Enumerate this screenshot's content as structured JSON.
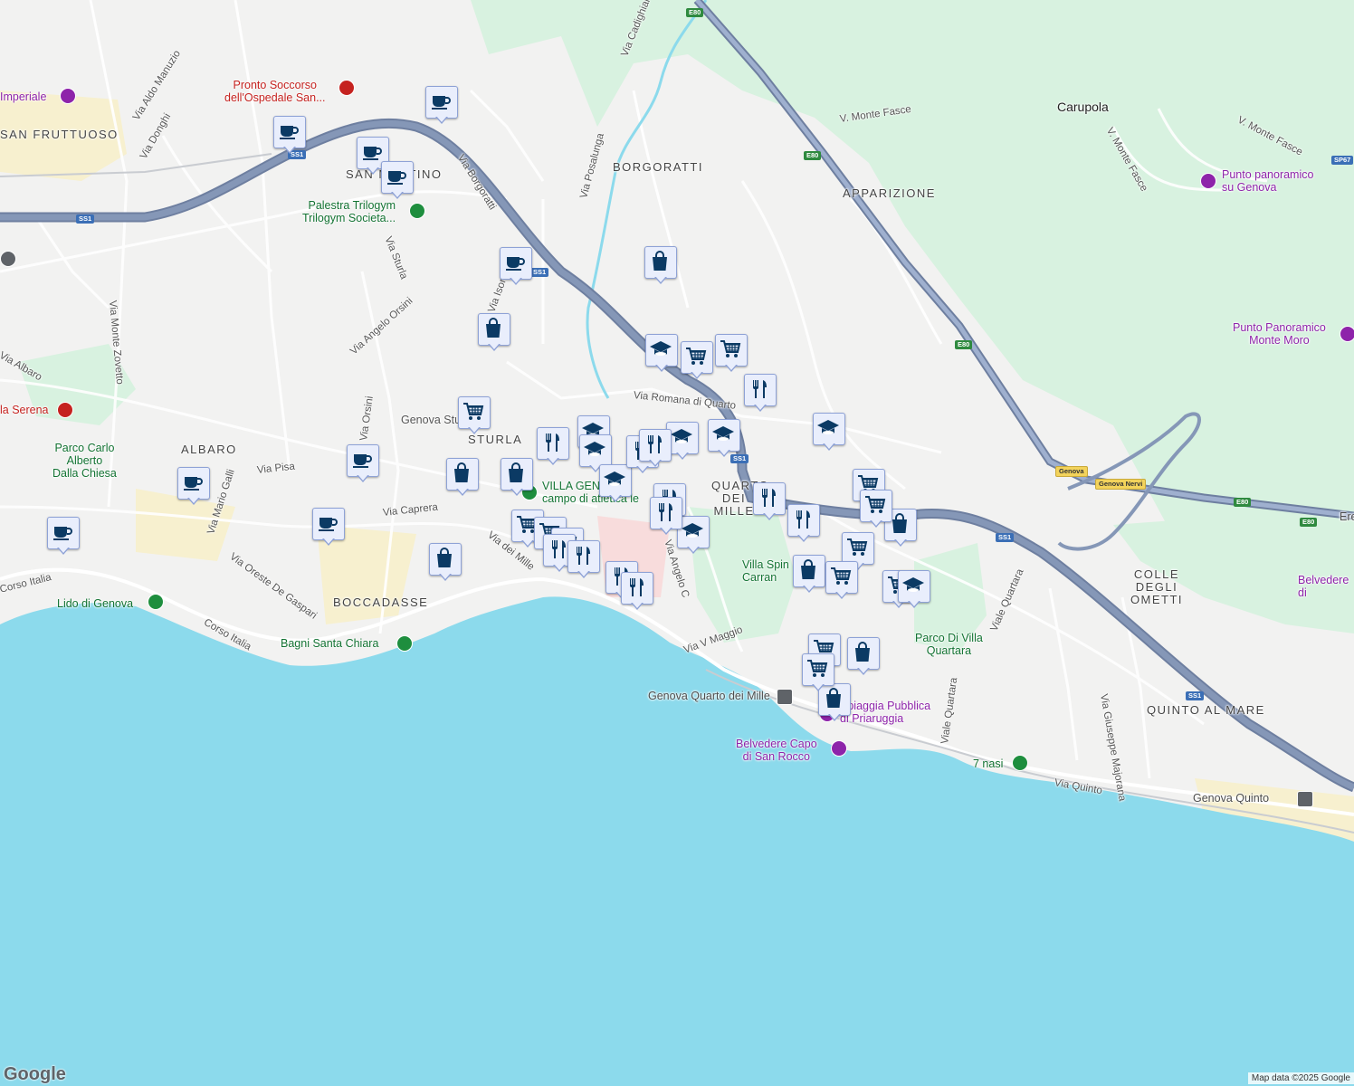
{
  "map": {
    "colors": {
      "water": "#8cdaec",
      "land": "#f2f2f1",
      "park": "#d8f2e0",
      "highway": "#8597b7",
      "highway_outline": "#6e7fa0",
      "dense": "#e6e6e4",
      "yellow_block": "#f7ecb0"
    },
    "area_labels": [
      {
        "id": "san-fruttuoso",
        "text": "SAN FRUTTUOSO"
      },
      {
        "id": "borgoratti",
        "text": "BORGORATTI"
      },
      {
        "id": "apparizione",
        "text": "APPARIZIONE"
      },
      {
        "id": "sturla",
        "text": "STURLA"
      },
      {
        "id": "albaro",
        "text": "ALBARO"
      },
      {
        "id": "boccadasse",
        "text": "BOCCADASSE"
      },
      {
        "id": "quarto-dei-mille",
        "text": "QUARTO DEI MILLE"
      },
      {
        "id": "colle-degli-ometti",
        "text": "COLLE DEGLI OMETTI"
      },
      {
        "id": "quinto-al-mare",
        "text": "QUINTO AL MARE"
      },
      {
        "id": "san-martino",
        "text": "SAN MARTINO"
      }
    ],
    "town_labels": [
      {
        "id": "carupola",
        "text": "Carupola"
      }
    ],
    "street_labels": [
      {
        "id": "via-aldo-manuzio",
        "text": "Via Aldo Manuzio"
      },
      {
        "id": "via-donghi",
        "text": "Via Donghi"
      },
      {
        "id": "via-borgoratti",
        "text": "Via Borgoratti"
      },
      {
        "id": "via-cadighiara",
        "text": "Via Cadighiara"
      },
      {
        "id": "via-posalunga",
        "text": "Via Posalunga"
      },
      {
        "id": "v-monte-fasce-1",
        "text": "V. Monte Fasce"
      },
      {
        "id": "v-monte-fasce-2",
        "text": "V. Monte Fasce"
      },
      {
        "id": "v-monte-fasce-3",
        "text": "V. Monte Fasce"
      },
      {
        "id": "via-sturla",
        "text": "Via Sturla"
      },
      {
        "id": "via-isonzo",
        "text": "Via Isonzo"
      },
      {
        "id": "via-monte-zovetto",
        "text": "Via Monte Zovetto"
      },
      {
        "id": "via-angelo-orsini",
        "text": "Via Angelo Orsini"
      },
      {
        "id": "via-albaro",
        "text": "Via Albaro"
      },
      {
        "id": "via-romana-di-quarto",
        "text": "Via Romana di Quarto"
      },
      {
        "id": "genova-sturla",
        "text": "Genova Stu"
      },
      {
        "id": "via-pisa",
        "text": "Via Pisa"
      },
      {
        "id": "via-mario-galli",
        "text": "Via Mario Galli"
      },
      {
        "id": "via-caprera",
        "text": "Via Caprera"
      },
      {
        "id": "via-dei-mille",
        "text": "Via dei Mille"
      },
      {
        "id": "via-oreste-de-gaspari",
        "text": "Via Oreste De Gaspari"
      },
      {
        "id": "corso-italia-1",
        "text": "Corso Italia"
      },
      {
        "id": "corso-italia-2",
        "text": "Corso Italia"
      },
      {
        "id": "via-angelo-carrara",
        "text": "Via Angelo C"
      },
      {
        "id": "via-v-maggio",
        "text": "Via V Maggio"
      },
      {
        "id": "viale-quartara-1",
        "text": "Viale Quartara"
      },
      {
        "id": "viale-quartara-2",
        "text": "Viale Quartara"
      },
      {
        "id": "via-giuseppe-majorana",
        "text": "Via Giuseppe Majorana"
      },
      {
        "id": "via-quinto",
        "text": "Via Quinto"
      },
      {
        "id": "via-orsini",
        "text": "Via Orsini"
      }
    ],
    "poi_labels": [
      {
        "id": "pronto-soccorso",
        "text": "Pronto Soccorso\ndell'Ospedale San...",
        "kind": "hospital"
      },
      {
        "id": "imperiale",
        "text": "Imperiale",
        "kind": "attraction"
      },
      {
        "id": "palestra-trilogym",
        "text": "Palestra Trilogym\nTrilogym Societa...",
        "kind": "sport"
      },
      {
        "id": "villa-serena",
        "text": "la Serena",
        "kind": "hospital"
      },
      {
        "id": "parco-carlo-alberto",
        "text": "Parco Carlo\nAlberto\nDalla Chiesa",
        "kind": "park"
      },
      {
        "id": "lido-di-genova",
        "text": "Lido di Genova",
        "kind": "sport"
      },
      {
        "id": "bagni-santa-chiara",
        "text": "Bagni Santa Chiara",
        "kind": "sport"
      },
      {
        "id": "villa-gentile",
        "text": "VILLA GEN\ncampo di atletica le",
        "kind": "sport"
      },
      {
        "id": "villa-spinola",
        "text": "Villa Spin\nCarran",
        "kind": "park"
      },
      {
        "id": "genova-quarto",
        "text": "Genova Quarto dei Mille",
        "kind": "transit"
      },
      {
        "id": "spiaggia-priaruggia",
        "text": "Spiaggia Pubblica\ndi Priaruggia",
        "kind": "attraction"
      },
      {
        "id": "belvedere-capo-san-rocco",
        "text": "Belvedere Capo\ndi San Rocco",
        "kind": "attraction"
      },
      {
        "id": "parco-villa-quartara",
        "text": "Parco Di Villa\nQuartara",
        "kind": "park"
      },
      {
        "id": "sette-nasi",
        "text": "7 nasi",
        "kind": "sport"
      },
      {
        "id": "genova-quinto",
        "text": "Genova Quinto",
        "kind": "transit"
      },
      {
        "id": "punto-panoramico-genova",
        "text": "Punto panoramico\nsu Genova",
        "kind": "attraction"
      },
      {
        "id": "punto-panoramico-monte-moro",
        "text": "Punto Panoramico\nMonte Moro",
        "kind": "attraction"
      },
      {
        "id": "belvedere-right",
        "text": "Belvedere\ndi",
        "kind": "attraction"
      },
      {
        "id": "ere",
        "text": "Ere",
        "kind": "place"
      }
    ],
    "road_shields": [
      {
        "id": "ss1-a",
        "text": "SS1",
        "kind": "blue"
      },
      {
        "id": "ss1-b",
        "text": "SS1",
        "kind": "blue"
      },
      {
        "id": "ss1-c",
        "text": "SS1",
        "kind": "blue"
      },
      {
        "id": "ss1-d",
        "text": "SS1",
        "kind": "blue"
      },
      {
        "id": "ss1-e",
        "text": "SS1",
        "kind": "blue"
      },
      {
        "id": "ss1-f",
        "text": "SS1",
        "kind": "blue"
      },
      {
        "id": "e80-a",
        "text": "E80",
        "kind": "green"
      },
      {
        "id": "e80-b",
        "text": "E80",
        "kind": "green"
      },
      {
        "id": "e80-c",
        "text": "E80",
        "kind": "green"
      },
      {
        "id": "e80-d",
        "text": "E80",
        "kind": "green"
      },
      {
        "id": "e80-e",
        "text": "E80",
        "kind": "green"
      },
      {
        "id": "sp67",
        "text": "SP67",
        "kind": "blue"
      },
      {
        "id": "genova-exit",
        "text": "Genova",
        "kind": "yellow"
      },
      {
        "id": "genova-nervi-exit",
        "text": "Genova Nervi",
        "kind": "yellow"
      }
    ],
    "markers": [
      {
        "type": "cafe",
        "icon": "coffee-cup-icon"
      },
      {
        "type": "cafe",
        "icon": "coffee-cup-icon"
      },
      {
        "type": "cafe",
        "icon": "coffee-cup-icon"
      },
      {
        "type": "cafe",
        "icon": "coffee-cup-icon"
      },
      {
        "type": "cafe",
        "icon": "coffee-cup-icon"
      },
      {
        "type": "cafe",
        "icon": "coffee-cup-icon"
      },
      {
        "type": "cafe",
        "icon": "coffee-cup-icon"
      },
      {
        "type": "cafe",
        "icon": "coffee-cup-icon"
      },
      {
        "type": "cafe",
        "icon": "coffee-cup-icon"
      },
      {
        "type": "shop",
        "icon": "shopping-bag-icon"
      },
      {
        "type": "shop",
        "icon": "shopping-bag-icon"
      },
      {
        "type": "shop",
        "icon": "shopping-bag-icon"
      },
      {
        "type": "shop",
        "icon": "shopping-bag-icon"
      },
      {
        "type": "shop",
        "icon": "shopping-bag-icon"
      },
      {
        "type": "shop",
        "icon": "shopping-bag-icon"
      },
      {
        "type": "shop",
        "icon": "shopping-bag-icon"
      },
      {
        "type": "shop",
        "icon": "shopping-bag-icon"
      },
      {
        "type": "shop",
        "icon": "shopping-bag-icon"
      },
      {
        "type": "grocery",
        "icon": "shopping-cart-icon"
      },
      {
        "type": "grocery",
        "icon": "shopping-cart-icon"
      },
      {
        "type": "grocery",
        "icon": "shopping-cart-icon"
      },
      {
        "type": "grocery",
        "icon": "shopping-cart-icon"
      },
      {
        "type": "grocery",
        "icon": "shopping-cart-icon"
      },
      {
        "type": "grocery",
        "icon": "shopping-cart-icon"
      },
      {
        "type": "grocery",
        "icon": "shopping-cart-icon"
      },
      {
        "type": "grocery",
        "icon": "shopping-cart-icon"
      },
      {
        "type": "grocery",
        "icon": "shopping-cart-icon"
      },
      {
        "type": "grocery",
        "icon": "shopping-cart-icon"
      },
      {
        "type": "grocery",
        "icon": "shopping-cart-icon"
      },
      {
        "type": "grocery",
        "icon": "shopping-cart-icon"
      },
      {
        "type": "grocery",
        "icon": "shopping-cart-icon"
      },
      {
        "type": "school",
        "icon": "graduation-cap-icon"
      },
      {
        "type": "school",
        "icon": "graduation-cap-icon"
      },
      {
        "type": "school",
        "icon": "graduation-cap-icon"
      },
      {
        "type": "school",
        "icon": "graduation-cap-icon"
      },
      {
        "type": "school",
        "icon": "graduation-cap-icon"
      },
      {
        "type": "school",
        "icon": "graduation-cap-icon"
      },
      {
        "type": "school",
        "icon": "graduation-cap-icon"
      },
      {
        "type": "school",
        "icon": "graduation-cap-icon"
      },
      {
        "type": "school",
        "icon": "graduation-cap-icon"
      },
      {
        "type": "restaurant",
        "icon": "fork-knife-icon"
      },
      {
        "type": "restaurant",
        "icon": "fork-knife-icon"
      },
      {
        "type": "restaurant",
        "icon": "fork-knife-icon"
      },
      {
        "type": "restaurant",
        "icon": "fork-knife-icon"
      },
      {
        "type": "restaurant",
        "icon": "fork-knife-icon"
      },
      {
        "type": "restaurant",
        "icon": "fork-knife-icon"
      },
      {
        "type": "restaurant",
        "icon": "fork-knife-icon"
      },
      {
        "type": "restaurant",
        "icon": "fork-knife-icon"
      },
      {
        "type": "restaurant",
        "icon": "fork-knife-icon"
      },
      {
        "type": "restaurant",
        "icon": "fork-knife-icon"
      },
      {
        "type": "restaurant",
        "icon": "fork-knife-icon"
      },
      {
        "type": "restaurant",
        "icon": "fork-knife-icon"
      }
    ],
    "footer": {
      "logo": "Google",
      "attribution": "Map data ©2025 Google"
    }
  }
}
